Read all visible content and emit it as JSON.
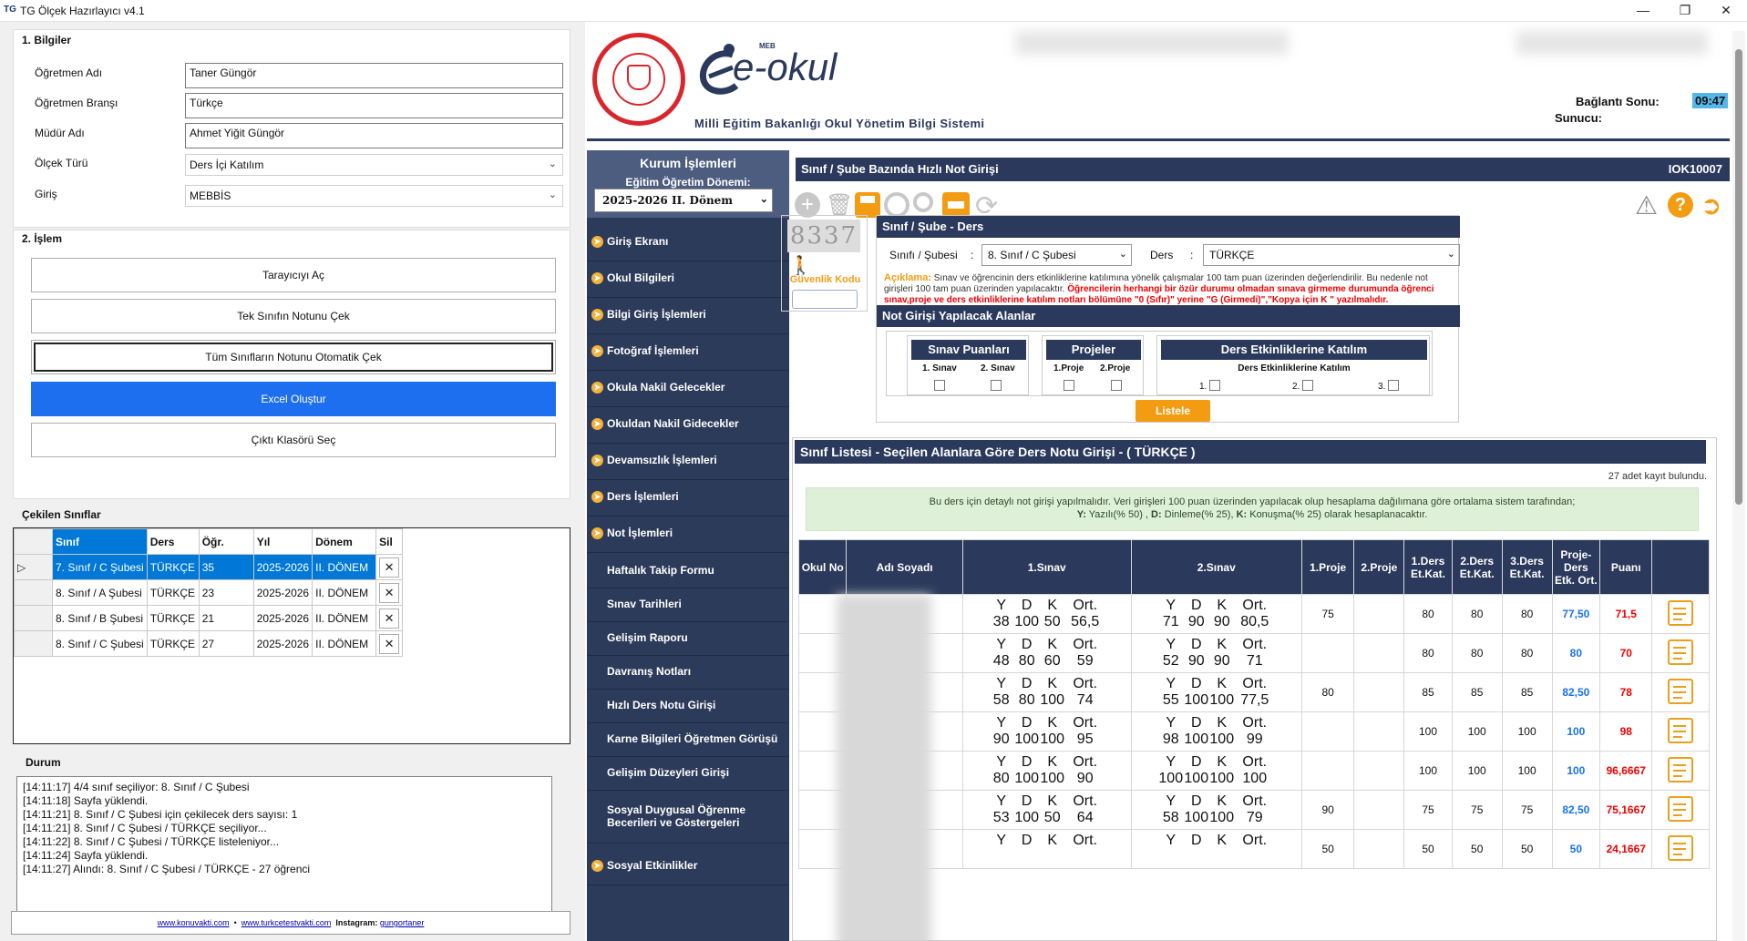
{
  "window": {
    "logo": "TG",
    "title": "TG Ölçek Hazırlayıcı v4.1"
  },
  "info": {
    "title": "1. Bilgiler",
    "teacher_label": "Öğretmen Adı",
    "teacher": "Taner Güngör",
    "branch_label": "Öğretmen Branşı",
    "branch": "Türkçe",
    "principal_label": "Müdür Adı",
    "principal": "Ahmet Yiğit Güngör",
    "scale_label": "Ölçek Türü",
    "scale": "Ders İçi Katılım",
    "entry_label": "Giriş",
    "entry": "MEBBİS"
  },
  "ops": {
    "title": "2. İşlem",
    "b1": "Tarayıcıyı Aç",
    "b2": "Tek Sınıfın Notunu Çek",
    "b3": "Tüm Sınıfların Notunu Otomatik Çek",
    "b4": "Excel Oluştur",
    "b5": "Çıktı Klasörü Seç"
  },
  "classes": {
    "title": "Çekilen Sınıflar",
    "headers": [
      "Sınıf",
      "Ders",
      "Öğr.",
      "Yıl",
      "Dönem",
      "Sil"
    ],
    "rows": [
      {
        "c": "7. Sınıf / C Şubesi",
        "d": "TÜRKÇE",
        "n": "35",
        "y": "2025-2026",
        "p": "II. DÖNEM"
      },
      {
        "c": "8. Sınıf / A Şubesi",
        "d": "TÜRKÇE",
        "n": "23",
        "y": "2025-2026",
        "p": "II. DÖNEM"
      },
      {
        "c": "8. Sınıf / B Şubesi",
        "d": "TÜRKÇE",
        "n": "21",
        "y": "2025-2026",
        "p": "II. DÖNEM"
      },
      {
        "c": "8. Sınıf / C Şubesi",
        "d": "TÜRKÇE",
        "n": "27",
        "y": "2025-2026",
        "p": "II. DÖNEM"
      }
    ]
  },
  "status": {
    "title": "Durum",
    "lines": [
      "[14:11:17] 4/4 sınıf seçiliyor: 8. Sınıf / C Şubesi",
      "[14:11:18] Sayfa yüklendi.",
      "[14:11:21] 8. Sınıf / C Şubesi için çekilecek ders sayısı: 1",
      "[14:11:21] 8. Sınıf / C Şubesi / TÜRKÇE seçiliyor...",
      "[14:11:22] 8. Sınıf / C Şubesi / TÜRKÇE listeleniyor...",
      "[14:11:24] Sayfa yüklendi.",
      "[14:11:27] Alındı: 8. Sınıf / C Şubesi / TÜRKÇE - 27 öğrenci"
    ]
  },
  "footer": {
    "l1": "www.konuvakti.com",
    "sep": "•",
    "l2": "www.turkcetestvakti.com",
    "ig_label": "Instagram:",
    "ig": "gungortaner"
  },
  "eokul": {
    "meb": "MEB",
    "brand": "e-okul",
    "subtitle": "Milli Eğitim Bakanlığı Okul Yönetim Bilgi Sistemi",
    "conn_label": "Bağlantı Sonu:",
    "conn": "09:47",
    "server_label": "Sunucu:",
    "kurum": "Kurum İşlemleri",
    "donem_label": "Eğitim Öğretim Dönemi:",
    "donem": "2025-2026 II. Dönem",
    "menu": [
      "Giriş Ekranı",
      "Okul Bilgileri",
      "Bilgi Giriş İşlemleri",
      "Fotoğraf İşlemleri",
      "Okula Nakil Gelecekler",
      "Okuldan Nakil Gidecekler",
      "Devamsızlık İşlemleri",
      "Ders İşlemleri",
      "Not İşlemleri"
    ],
    "submenu": [
      "Haftalık Takip Formu",
      "Sınav Tarihleri",
      "Gelişim Raporu",
      "Davranış Notları",
      "Hızlı Ders Notu Girişi",
      "Karne Bilgileri Öğretmen Görüşü",
      "Gelişim Düzeyleri Girişi",
      "Sosyal Duygusal Öğrenme Becerileri ve Göstergeleri"
    ],
    "menu_last": "Sosyal Etkinlikler",
    "page_title": "Sınıf / Şube Bazında Hızlı Not Girişi",
    "page_code": "IOK10007",
    "captcha": "8337",
    "captcha_label": "Güvenlik Kodu",
    "sd_title": "Sınıf / Şube  - Ders",
    "sube_label": "Sınıfı / Şubesi",
    "colon": ":",
    "sube": "8. Sınıf / C Şubesi",
    "ders_label": "Ders",
    "ders": "TÜRKÇE",
    "aciklama_label": "Açıklama:",
    "aciklama": "Sınav ve öğrencinin ders etkinliklerine katılımına yönelik çalışmalar 100 tam puan üzerinden değerlendirilir. Bu nedenle not girişleri 100 tam puan üzerinden yapılacaktır.",
    "aciklama_red": "Öğrencilerin herhangi bir özür durumu olmadan sınava girmeme durumunda öğrenci sınav,proje ve ders etkinliklerine katılım notları bölümüne \"0 (Sıfır)\" yerine \"G (Girmedi)\",\"Kopya için K \" yazılmalıdır.",
    "alanlar_title": "Not Girişi Yapılacak Alanlar",
    "sinav_title": "Sınav Puanları",
    "s1": "1. Sınav",
    "s2": "2. Sınav",
    "proje_title": "Projeler",
    "p1": "1.Proje",
    "p2": "2.Proje",
    "etk_title": "Ders Etkinliklerine Katılım",
    "etk_sub": "Ders Etkinliklerine Katılım",
    "e1": "1.",
    "e2": "2.",
    "e3": "3.",
    "listele": "Listele",
    "list_title": "Sınıf Listesi - Seçilen Alanlara Göre Ders Notu Girişi - ( TÜRKÇE )",
    "kayit": "27 adet kayıt bulundu.",
    "info1": "Bu ders için detaylı not girişi yapılmalıdır. Veri girişleri 100 puan üzerinden yapılacak olup hesaplama dağılımana göre ortalama sistem tarafından;",
    "info2_y": "Y:",
    "info2_yt": " Yazılı(% 50) , ",
    "info2_d": "D:",
    "info2_dt": " Dinleme(% 25), ",
    "info2_k": "K:",
    "info2_kt": " Konuşma(% 25) olarak hesaplanacaktır.",
    "th": [
      "Okul No",
      "Adı Soyadı",
      "1.Sınav",
      "2.Sınav",
      "1.Proje",
      "2.Proje",
      "1.Ders Et.Kat.",
      "2.Ders Et.Kat.",
      "3.Ders Et.Kat.",
      "Proje-Ders Etk. Ort.",
      "Puanı"
    ],
    "sub": [
      "Y",
      "D",
      "K",
      "Ort."
    ],
    "rows": [
      {
        "s1": [
          "38",
          "100",
          "50",
          "56,5"
        ],
        "s2": [
          "71",
          "90",
          "90",
          "80,5"
        ],
        "p1": "75",
        "e1": "80",
        "e2": "80",
        "e3": "80",
        "ort": "77,50",
        "puan": "71,5"
      },
      {
        "s1": [
          "48",
          "80",
          "60",
          "59"
        ],
        "s2": [
          "52",
          "90",
          "90",
          "71"
        ],
        "p1": "",
        "e1": "80",
        "e2": "80",
        "e3": "80",
        "ort": "80",
        "puan": "70"
      },
      {
        "s1": [
          "58",
          "80",
          "100",
          "74"
        ],
        "s2": [
          "55",
          "100",
          "100",
          "77,5"
        ],
        "p1": "80",
        "e1": "85",
        "e2": "85",
        "e3": "85",
        "ort": "82,50",
        "puan": "78"
      },
      {
        "s1": [
          "90",
          "100",
          "100",
          "95"
        ],
        "s2": [
          "98",
          "100",
          "100",
          "99"
        ],
        "p1": "",
        "e1": "100",
        "e2": "100",
        "e3": "100",
        "ort": "100",
        "puan": "98"
      },
      {
        "s1": [
          "80",
          "100",
          "100",
          "90"
        ],
        "s2": [
          "100",
          "100",
          "100",
          "100"
        ],
        "p1": "",
        "e1": "100",
        "e2": "100",
        "e3": "100",
        "ort": "100",
        "puan": "96,6667"
      },
      {
        "s1": [
          "53",
          "100",
          "50",
          "64"
        ],
        "s2": [
          "58",
          "100",
          "100",
          "79"
        ],
        "p1": "90",
        "e1": "75",
        "e2": "75",
        "e3": "75",
        "ort": "82,50",
        "puan": "75,1667"
      },
      {
        "s1": [
          "",
          "",
          "",
          ""
        ],
        "s2": [
          "",
          "",
          "",
          ""
        ],
        "p1": "50",
        "e1": "50",
        "e2": "50",
        "e3": "50",
        "ort": "50",
        "puan": "24,1667"
      }
    ]
  },
  "colors": {
    "navy": "#2b3a5c",
    "sidebar": "#2d3b5a",
    "accent_blue": "#1e6ff0",
    "orange": "#f39c12",
    "red": "#e00000",
    "link_blue": "#1a73e8"
  }
}
